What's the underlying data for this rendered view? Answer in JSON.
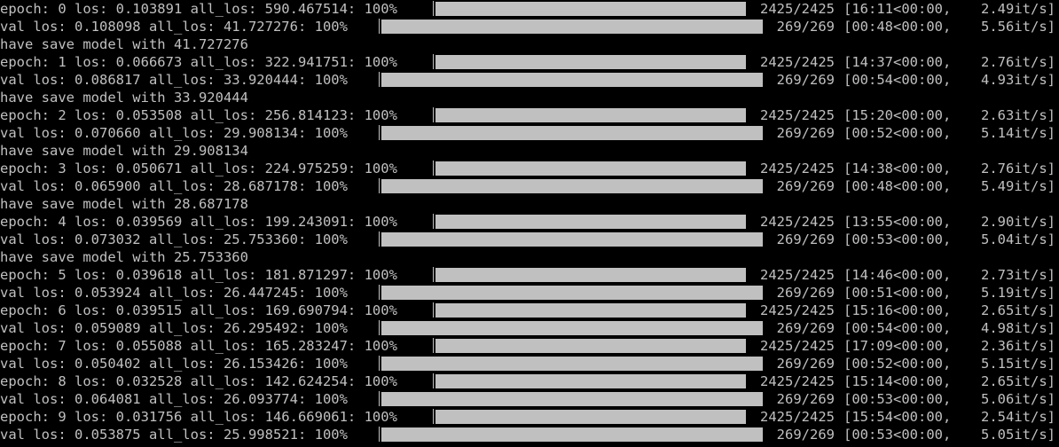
{
  "progress": 1.0,
  "lines": [
    {
      "kind": "train",
      "label": "epoch: 0 los: 0.103891 all_los: 590.467514: 100%",
      "counter": "2425/2425",
      "time": "[16:11<00:00,",
      "rate": "2.49it/s]"
    },
    {
      "kind": "val",
      "label": "val los: 0.108098 all_los: 41.727276: 100%",
      "counter": "269/269",
      "time": "[00:48<00:00,",
      "rate": "5.56it/s]"
    },
    {
      "kind": "save",
      "text": "have save model with 41.727276"
    },
    {
      "kind": "train",
      "label": "epoch: 1 los: 0.066673 all_los: 322.941751: 100%",
      "counter": "2425/2425",
      "time": "[14:37<00:00,",
      "rate": "2.76it/s]"
    },
    {
      "kind": "val",
      "label": "val los: 0.086817 all_los: 33.920444: 100%",
      "counter": "269/269",
      "time": "[00:54<00:00,",
      "rate": "4.93it/s]"
    },
    {
      "kind": "save",
      "text": "have save model with 33.920444"
    },
    {
      "kind": "train",
      "label": "epoch: 2 los: 0.053508 all_los: 256.814123: 100%",
      "counter": "2425/2425",
      "time": "[15:20<00:00,",
      "rate": "2.63it/s]"
    },
    {
      "kind": "val",
      "label": "val los: 0.070660 all_los: 29.908134: 100%",
      "counter": "269/269",
      "time": "[00:52<00:00,",
      "rate": "5.14it/s]"
    },
    {
      "kind": "save",
      "text": "have save model with 29.908134"
    },
    {
      "kind": "train",
      "label": "epoch: 3 los: 0.050671 all_los: 224.975259: 100%",
      "counter": "2425/2425",
      "time": "[14:38<00:00,",
      "rate": "2.76it/s]"
    },
    {
      "kind": "val",
      "label": "val los: 0.065900 all_los: 28.687178: 100%",
      "counter": "269/269",
      "time": "[00:48<00:00,",
      "rate": "5.49it/s]"
    },
    {
      "kind": "save",
      "text": "have save model with 28.687178"
    },
    {
      "kind": "train",
      "label": "epoch: 4 los: 0.039569 all_los: 199.243091: 100%",
      "counter": "2425/2425",
      "time": "[13:55<00:00,",
      "rate": "2.90it/s]"
    },
    {
      "kind": "val",
      "label": "val los: 0.073032 all_los: 25.753360: 100%",
      "counter": "269/269",
      "time": "[00:53<00:00,",
      "rate": "5.04it/s]"
    },
    {
      "kind": "save",
      "text": "have save model with 25.753360"
    },
    {
      "kind": "train",
      "label": "epoch: 5 los: 0.039618 all_los: 181.871297: 100%",
      "counter": "2425/2425",
      "time": "[14:46<00:00,",
      "rate": "2.73it/s]"
    },
    {
      "kind": "val",
      "label": "val los: 0.053924 all_los: 26.447245: 100%",
      "counter": "269/269",
      "time": "[00:51<00:00,",
      "rate": "5.19it/s]"
    },
    {
      "kind": "train",
      "label": "epoch: 6 los: 0.039515 all_los: 169.690794: 100%",
      "counter": "2425/2425",
      "time": "[15:16<00:00,",
      "rate": "2.65it/s]"
    },
    {
      "kind": "val",
      "label": "val los: 0.059089 all_los: 26.295492: 100%",
      "counter": "269/269",
      "time": "[00:54<00:00,",
      "rate": "4.98it/s]"
    },
    {
      "kind": "train",
      "label": "epoch: 7 los: 0.055088 all_los: 165.283247: 100%",
      "counter": "2425/2425",
      "time": "[17:09<00:00,",
      "rate": "2.36it/s]"
    },
    {
      "kind": "val",
      "label": "val los: 0.050402 all_los: 26.153426: 100%",
      "counter": "269/269",
      "time": "[00:52<00:00,",
      "rate": "5.15it/s]"
    },
    {
      "kind": "train",
      "label": "epoch: 8 los: 0.032528 all_los: 142.624254: 100%",
      "counter": "2425/2425",
      "time": "[15:14<00:00,",
      "rate": "2.65it/s]"
    },
    {
      "kind": "val",
      "label": "val los: 0.064081 all_los: 26.093774: 100%",
      "counter": "269/269",
      "time": "[00:53<00:00,",
      "rate": "5.06it/s]"
    },
    {
      "kind": "train",
      "label": "epoch: 9 los: 0.031756 all_los: 146.669061: 100%",
      "counter": "2425/2425",
      "time": "[15:54<00:00,",
      "rate": "2.54it/s]"
    },
    {
      "kind": "val",
      "label": "val los: 0.053875 all_los: 25.998521: 100%",
      "counter": "269/269",
      "time": "[00:53<00:00,",
      "rate": "5.05it/s]"
    }
  ]
}
